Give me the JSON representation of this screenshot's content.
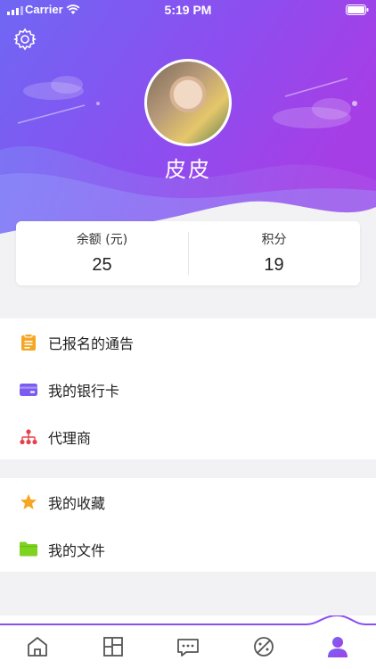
{
  "status_bar": {
    "carrier": "Carrier",
    "time": "5:19 PM"
  },
  "profile": {
    "username": "皮皮"
  },
  "stats": [
    {
      "label": "余额 (元)",
      "value": "25"
    },
    {
      "label": "积分",
      "value": "19"
    }
  ],
  "menu_group_1": [
    {
      "label": "已报名的通告",
      "icon": "clipboard-icon",
      "color": "#f5a623"
    },
    {
      "label": "我的银行卡",
      "icon": "bank-card-icon",
      "color": "#7b5cf0"
    },
    {
      "label": "代理商",
      "icon": "org-chart-icon",
      "color": "#e8414b"
    }
  ],
  "menu_group_2": [
    {
      "label": "我的收藏",
      "icon": "star-icon",
      "color": "#f5a623"
    },
    {
      "label": "我的文件",
      "icon": "folder-icon",
      "color": "#7ed321"
    }
  ],
  "tabbar": {
    "active_index": 4,
    "items": [
      "home-icon",
      "grid-icon",
      "chat-icon",
      "discover-icon",
      "profile-icon"
    ],
    "active_color": "#8a4df0",
    "inactive_color": "#555555"
  },
  "colors": {
    "gradient_start": "#6a5cf5",
    "gradient_end": "#a23ee8"
  }
}
